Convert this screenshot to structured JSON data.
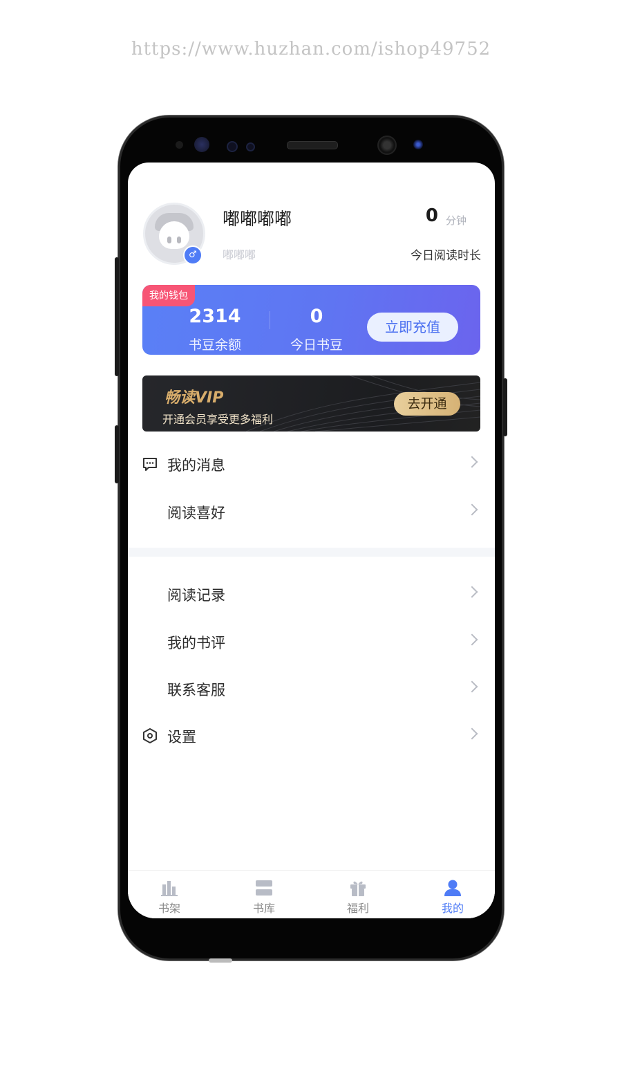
{
  "watermark": "https://www.huzhan.com/ishop49752",
  "profile": {
    "username": "嘟嘟嘟嘟",
    "subname": "嘟嘟嘟",
    "read_time_value": "0",
    "read_time_unit": "分钟",
    "read_time_label": "今日阅读时长"
  },
  "wallet": {
    "tag": "我的钱包",
    "balance_value": "2314",
    "balance_label": "书豆余额",
    "today_value": "0",
    "today_label": "今日书豆",
    "recharge_label": "立即充值"
  },
  "vip": {
    "title": "畅读VIP",
    "subtitle": "开通会员享受更多福利",
    "button": "去开通"
  },
  "menu": {
    "group1": [
      {
        "label": "我的消息",
        "icon": "message-icon"
      },
      {
        "label": "阅读喜好",
        "icon": ""
      }
    ],
    "group2": [
      {
        "label": "阅读记录",
        "icon": ""
      },
      {
        "label": "我的书评",
        "icon": ""
      },
      {
        "label": "联系客服",
        "icon": ""
      },
      {
        "label": "设置",
        "icon": "settings-icon"
      }
    ]
  },
  "tabbar": {
    "items": [
      {
        "label": "书架",
        "icon": "bookshelf-icon"
      },
      {
        "label": "书库",
        "icon": "library-icon"
      },
      {
        "label": "福利",
        "icon": "gift-icon"
      },
      {
        "label": "我的",
        "icon": "user-icon"
      }
    ],
    "active_index": 3
  },
  "colors": {
    "accent": "#4f7cf6",
    "wallet_tag": "#f75575",
    "vip_gold": "#d8ad6b"
  }
}
